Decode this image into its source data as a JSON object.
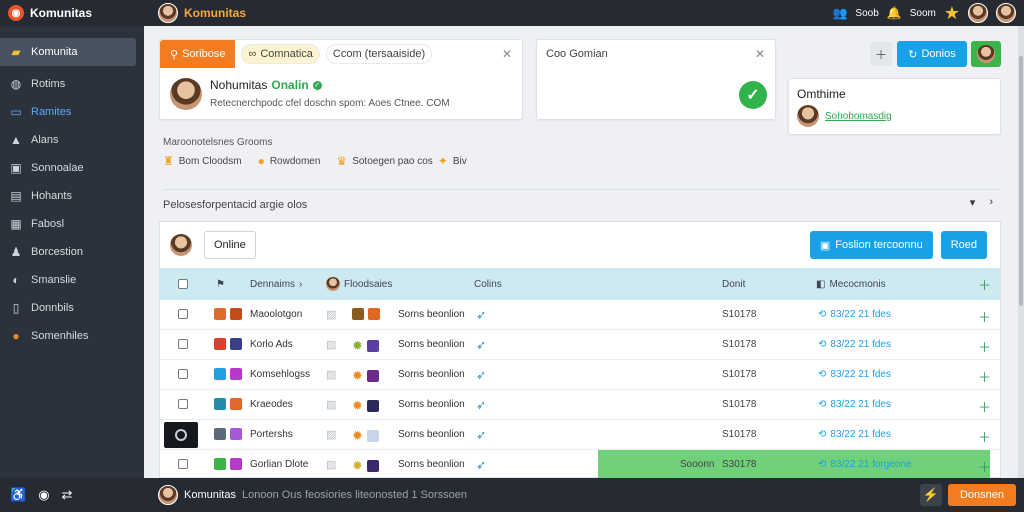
{
  "app": {
    "name": "Komunitas"
  },
  "header": {
    "title": "Komunitas",
    "right_text_1": "Soob",
    "right_text_2": "Soom"
  },
  "sidebar": {
    "items": [
      {
        "label": "Komunita",
        "icon": "folder-icon"
      },
      {
        "label": "Rotims",
        "icon": "globe-icon"
      },
      {
        "label": "Ramites",
        "icon": "monitor-icon"
      },
      {
        "label": "Alans",
        "icon": "person-icon"
      },
      {
        "label": "Sonnoalae",
        "icon": "lock-icon"
      },
      {
        "label": "Hohants",
        "icon": "bag-icon"
      },
      {
        "label": "Fabosl",
        "icon": "book-icon"
      },
      {
        "label": "Borcestion",
        "icon": "user-icon"
      },
      {
        "label": "Smanslie",
        "icon": "chat-icon"
      },
      {
        "label": "Donnbils",
        "icon": "file-icon"
      },
      {
        "label": "Somenhiles",
        "icon": "badge-icon"
      }
    ]
  },
  "card1": {
    "tab_active": "Soribose",
    "tab_2": "Comnatica",
    "tab_3": "Ccom (tersaaiside)",
    "name": "Nohumitas",
    "status": "Onalin",
    "description": "Retecnerchpodc cfel doschn spom: Aoes Ctnee. COM"
  },
  "card2": {
    "title": "Coo Gomian"
  },
  "top_actions": {
    "primary_label": "Donios"
  },
  "card3": {
    "title": "Omthime",
    "link": "Sohobomasdig"
  },
  "section": {
    "label": "Maroonotelsnes Grooms",
    "chips": [
      {
        "label": "Bom Cloodsm"
      },
      {
        "label": "Rowdomen"
      },
      {
        "label": "Sotoegen pao cos"
      },
      {
        "label": "Biv"
      }
    ],
    "heading": "Pelosesforpentacid argie olos"
  },
  "panel": {
    "online_label": "Online",
    "primary_button": "Foslion tercoonnu",
    "secondary_button": "Roed"
  },
  "table": {
    "headers": {
      "name": "Dennaims",
      "feature": "Floodsaies",
      "col3": "Colins",
      "count": "Donit",
      "time": "Mecocmonis"
    },
    "rows": [
      {
        "name": "Maoolotgon",
        "feature": "Sorns beonlion",
        "count": "S10178",
        "time": "83/22 21 fdes"
      },
      {
        "name": "Korlo Ads",
        "feature": "Sorns beonlion",
        "count": "S10178",
        "time": "83/22 21 fdes"
      },
      {
        "name": "Komsehlogss",
        "feature": "Sorns beonlion",
        "count": "S10178",
        "time": "83/22 21 fdes"
      },
      {
        "name": "Kraeodes",
        "feature": "Sorns beonlion",
        "count": "S10178",
        "time": "83/22 21 fdes"
      },
      {
        "name": "Portershs",
        "feature": "Sorns beonlion",
        "count": "S10178",
        "time": "83/22 21 fdes"
      },
      {
        "name": "Gorlian Dlote",
        "feature": "Sorns beonlion",
        "count": "S30178",
        "time": "83/22 21 forgeone",
        "band_label": "Sooonn"
      }
    ]
  },
  "bottom": {
    "name": "Komunitas",
    "status": "Lonoon Ous feosiories liteonosted 1 Sorssoen",
    "button": "Donsnen"
  },
  "colors": {
    "accent": "#f47c20",
    "primary": "#17a2e8",
    "success": "#2fb34a"
  }
}
